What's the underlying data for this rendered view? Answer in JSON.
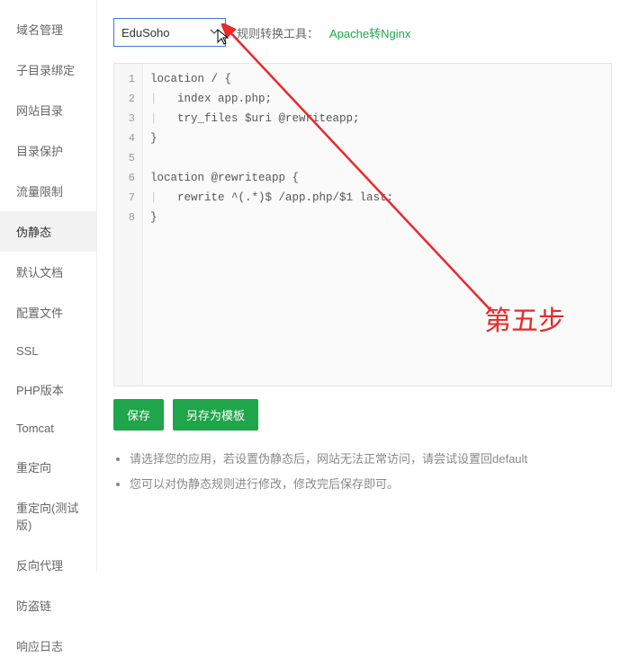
{
  "sidebar": {
    "items": [
      {
        "label": "域名管理"
      },
      {
        "label": "子目录绑定"
      },
      {
        "label": "网站目录"
      },
      {
        "label": "目录保护"
      },
      {
        "label": "流量限制"
      },
      {
        "label": "伪静态"
      },
      {
        "label": "默认文档"
      },
      {
        "label": "配置文件"
      },
      {
        "label": "SSL"
      },
      {
        "label": "PHP版本"
      },
      {
        "label": "Tomcat"
      },
      {
        "label": "重定向"
      },
      {
        "label": "重定向(测试版)"
      },
      {
        "label": "反向代理"
      },
      {
        "label": "防盗链"
      },
      {
        "label": "响应日志"
      }
    ],
    "active_index": 5
  },
  "top": {
    "select_value": "EduSoho",
    "tool_label": "规则转换工具：",
    "tool_link": "Apache转Nginx"
  },
  "code": {
    "lines": [
      "location / {",
      "    index app.php;",
      "    try_files $uri @rewriteapp;",
      "}",
      "",
      "location @rewriteapp {",
      "    rewrite ^(.*)$ /app.php/$1 last;",
      "}"
    ]
  },
  "buttons": {
    "save": "保存",
    "save_as": "另存为模板"
  },
  "tips": [
    "请选择您的应用，若设置伪静态后，网站无法正常访问，请尝试设置回default",
    "您可以对伪静态规则进行修改，修改完后保存即可。"
  ],
  "annotation": {
    "text": "第五步"
  }
}
